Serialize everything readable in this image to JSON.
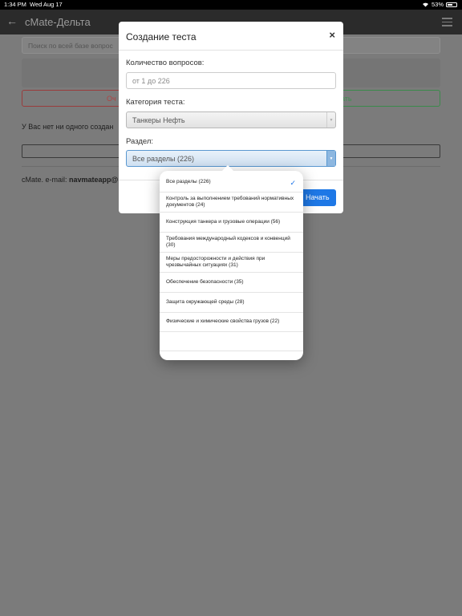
{
  "status_bar": {
    "time": "1:34 PM",
    "date": "Wed Aug 17",
    "battery": "53%"
  },
  "navbar": {
    "back_icon": "back-arrow-icon",
    "title": "cMate-Дельта",
    "menu_icon": "hamburger-icon"
  },
  "background": {
    "search_placeholder": "Поиск по всей базе вопрос",
    "left_button": "Оч",
    "right_button": "ать",
    "notice": "У Вас нет ни одного создан",
    "contact_prefix": "cMate. e-mail: ",
    "contact_email": "navmateapp@"
  },
  "modal": {
    "title": "Создание теста",
    "close_label": "×",
    "count_label": "Количество вопросов:",
    "count_placeholder": "от 1 до 226",
    "category_label": "Категория теста:",
    "category_value": "Танкеры Нефть",
    "section_label": "Раздел:",
    "section_value": "Все разделы (226)",
    "start_button": "Начать"
  },
  "dropdown": {
    "selected_index": 0,
    "options": [
      "Все разделы (226)",
      "Контроль за выполнением требований нормативных документов (24)",
      "Конструкция танкера и грузовые операции (56)",
      "Требования международный кодексов и конвенций (30)",
      "Меры предосторожности и действия при чрезвычайных ситуациях (31)",
      "Обеспечение безопасности (35)",
      "Защита окружающей среды (28)",
      "Физические и химические свойства грузов (22)"
    ]
  }
}
